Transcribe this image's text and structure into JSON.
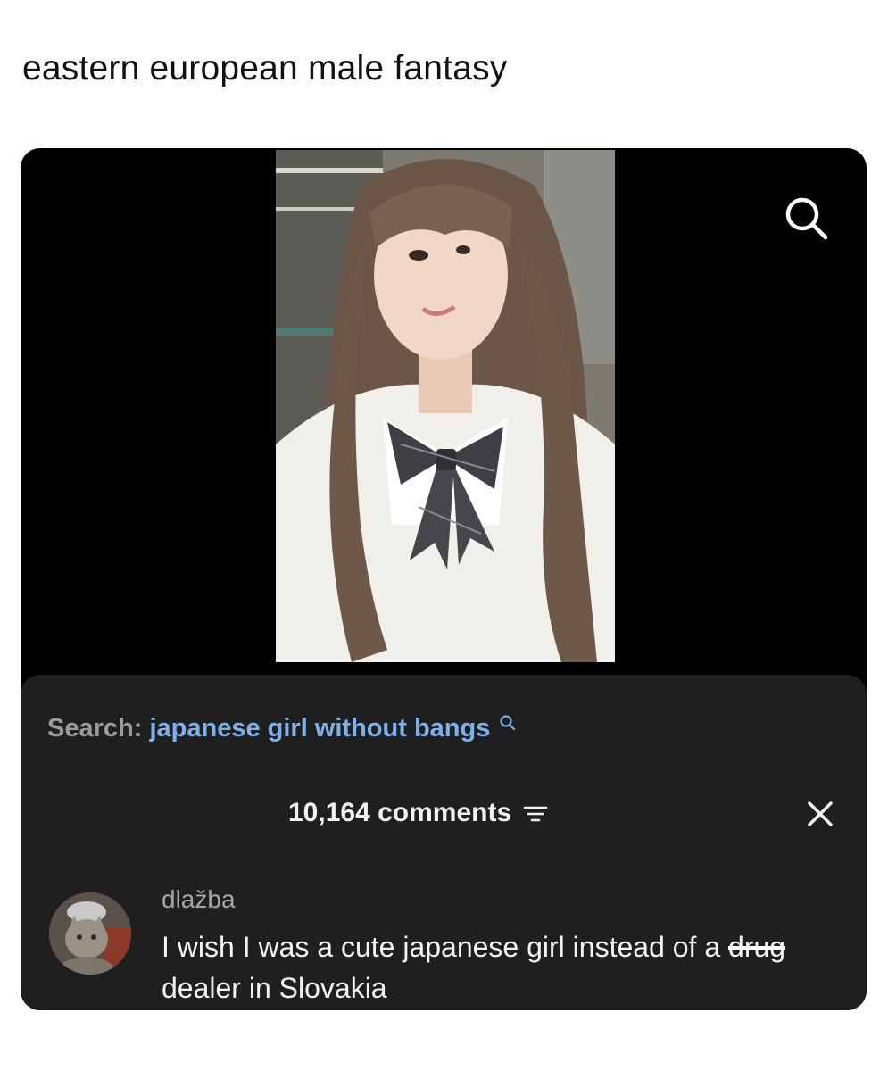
{
  "post": {
    "caption": "eastern european male fantasy"
  },
  "video": {
    "top_icon": "search-icon"
  },
  "comments_panel": {
    "search_prefix": "Search:",
    "search_query": "japanese girl without bangs",
    "search_query_icon": "search-icon",
    "comment_count": "10,164 comments",
    "sort_icon": "filter-icon",
    "close_icon": "close-icon",
    "comment": {
      "username": "dlažba",
      "text_before": "I wish I was a cute japanese girl instead of a ",
      "text_struck": "drug",
      "text_after": " dealer in Slovakia"
    }
  },
  "colors": {
    "page_background": "#ffffff",
    "screenshot_background": "#000000",
    "sheet_background": "#1f1f1f",
    "search_query_link": "#7fb0e8"
  }
}
